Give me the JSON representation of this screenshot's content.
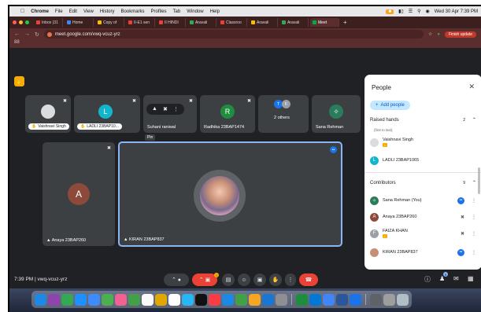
{
  "menubar": {
    "apple": "",
    "items": [
      "Chrome",
      "File",
      "Edit",
      "View",
      "History",
      "Bookmarks",
      "Profiles",
      "Tab",
      "Window",
      "Help"
    ],
    "datetime": "Wed 30 Apr 7:39 PM"
  },
  "tabs": [
    {
      "label": "Inbox (31",
      "color": "#ea4335"
    },
    {
      "label": "Home",
      "color": "#4285f4"
    },
    {
      "label": "Copy of",
      "color": "#fbbc04"
    },
    {
      "label": "II-E1 sen",
      "color": "#ea4335"
    },
    {
      "label": "II HINDI",
      "color": "#ea4335"
    },
    {
      "label": "Aravali",
      "color": "#34a853"
    },
    {
      "label": "Classroo",
      "color": "#ea4335"
    },
    {
      "label": "Aravali",
      "color": "#fbbc04"
    },
    {
      "label": "Aravali",
      "color": "#34a853"
    },
    {
      "label": "Meet",
      "color": "#00ac47",
      "active": true
    }
  ],
  "address": {
    "url": "meet.google.com/vwq-vcuz-yrz",
    "finish_update": "Finish update"
  },
  "bookmarks_icon": "88",
  "tiles": [
    {
      "name": "Vaishnavi Singh",
      "hand": true
    },
    {
      "name": "LADLI 23BAP10...",
      "initial": "L",
      "color": "#12b5cb",
      "hand": true
    },
    {
      "name": "Suhani raniwal"
    },
    {
      "name": "Radhika 23BAP1474",
      "initial": "R",
      "color": "#1e8e3e"
    },
    {
      "name": "2 others",
      "initials": [
        "T",
        "F"
      ]
    },
    {
      "name": "Sana Rehman"
    }
  ],
  "hover_tooltip": "Pin",
  "anaya_tile": {
    "name": "Anaya 23BAP260",
    "initial": "A",
    "color": "#8d4a3b"
  },
  "kiran_tile": {
    "name": "KIRAN 23BAP837"
  },
  "panel": {
    "title": "People",
    "add_people": "Add people",
    "raised_hands": {
      "label": "Raised hands",
      "count": "2"
    },
    "sort_note": "(first to last)",
    "raised": [
      {
        "name": "Vaishnavi Singh",
        "hand": true
      },
      {
        "name": "LADLI 23BAP1065",
        "initial": "L",
        "color": "#12b5cb"
      }
    ],
    "contributors": {
      "label": "Contributors",
      "count": "9"
    },
    "people": [
      {
        "name": "Sana Rehman (You)"
      },
      {
        "name": "Anaya 23BAP260",
        "initial": "A",
        "color": "#8d4a3b"
      },
      {
        "name": "FAIZA KHAN",
        "initial": "F",
        "color": "#9aa0a6",
        "hand": true
      },
      {
        "name": "KIRAN 23BAP837"
      }
    ]
  },
  "bottom": {
    "time": "7:39 PM",
    "separator": "|",
    "code": "vwq-vcuz-yrz",
    "people_count": "9"
  }
}
